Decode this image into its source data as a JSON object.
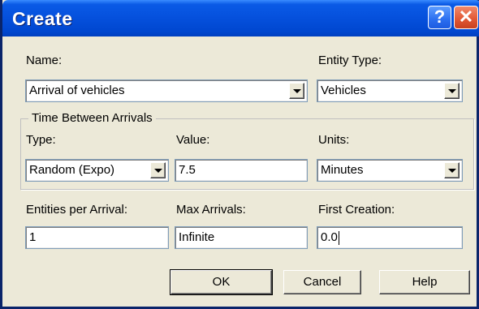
{
  "window": {
    "title": "Create",
    "help_glyph": "?",
    "close_glyph": "✕"
  },
  "name": {
    "label": "Name:",
    "value": "Arrival of vehicles"
  },
  "entity_type": {
    "label": "Entity Type:",
    "value": "Vehicles"
  },
  "time_between_arrivals": {
    "group_label": "Time Between Arrivals",
    "type_label": "Type:",
    "type_value": "Random (Expo)",
    "value_label": "Value:",
    "value": "7.5",
    "units_label": "Units:",
    "units_value": "Minutes"
  },
  "entities_per_arrival": {
    "label": "Entities per Arrival:",
    "value": "1"
  },
  "max_arrivals": {
    "label": "Max Arrivals:",
    "value": "Infinite"
  },
  "first_creation": {
    "label": "First Creation:",
    "value": "0.0"
  },
  "buttons": {
    "ok": "OK",
    "cancel": "Cancel",
    "help": "Help"
  }
}
